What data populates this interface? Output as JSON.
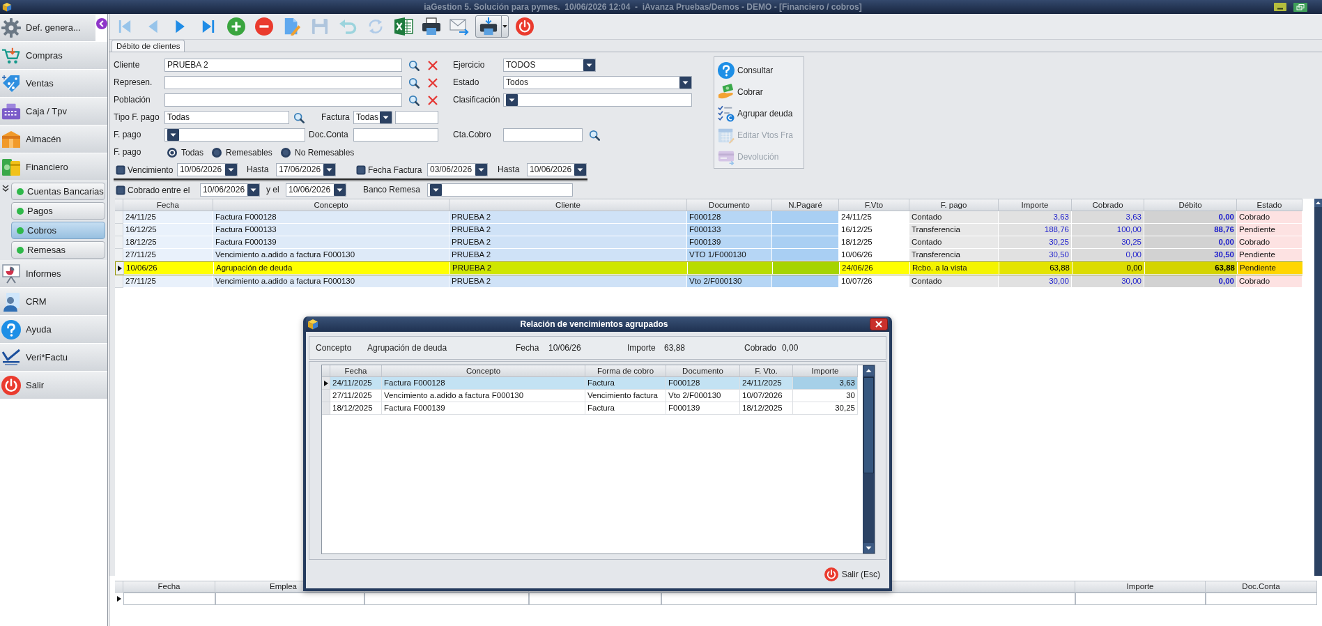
{
  "window": {
    "title": "iaGestion 5. Solución para pymes.  10/06/2026 12:04  -  iAvanza Pruebas/Demos - DEMO - [Financiero / cobros]"
  },
  "sidebar": {
    "items": [
      {
        "label": "Def. genera...",
        "kind": "settings"
      },
      {
        "label": "Compras",
        "kind": "cart"
      },
      {
        "label": "Ventas",
        "kind": "tag"
      },
      {
        "label": "Caja / Tpv",
        "kind": "register"
      },
      {
        "label": "Almacén",
        "kind": "box"
      },
      {
        "label": "Financiero",
        "kind": "money",
        "children": [
          {
            "label": "Cuentas Bancarias",
            "selected": false
          },
          {
            "label": "Pagos",
            "selected": false
          },
          {
            "label": "Cobros",
            "selected": true
          },
          {
            "label": "Remesas",
            "selected": false
          }
        ]
      },
      {
        "label": "Informes",
        "kind": "report"
      },
      {
        "label": "CRM",
        "kind": "contact"
      },
      {
        "label": "Ayuda",
        "kind": "help"
      },
      {
        "label": "Veri*Factu",
        "kind": "logo"
      },
      {
        "label": "Salir",
        "kind": "exit"
      }
    ]
  },
  "toolbar": {
    "buttons": [
      {
        "kind": "first",
        "disabled": true
      },
      {
        "kind": "previous",
        "disabled": true
      },
      {
        "kind": "next",
        "disabled": false
      },
      {
        "kind": "last",
        "disabled": false
      },
      {
        "kind": "add",
        "disabled": false
      },
      {
        "kind": "delete",
        "disabled": false
      },
      {
        "kind": "edit",
        "disabled": false
      },
      {
        "kind": "save",
        "disabled": true
      },
      {
        "kind": "undo",
        "disabled": true
      },
      {
        "kind": "refresh",
        "disabled": true
      },
      {
        "kind": "excel",
        "disabled": false
      },
      {
        "kind": "print",
        "disabled": false
      },
      {
        "kind": "email",
        "disabled": false
      },
      {
        "kind": "printmenu",
        "disabled": false
      },
      {
        "kind": "exit",
        "disabled": false
      }
    ]
  },
  "tabs": [
    {
      "label": "Débito de clientes",
      "selected": true
    }
  ],
  "filters": {
    "cliente": {
      "label": "Cliente",
      "value": "PRUEBA 2"
    },
    "represen": {
      "label": "Represen."
    },
    "poblacion": {
      "label": "Población"
    },
    "ejercicio": {
      "label": "Ejercicio",
      "value": "TODOS"
    },
    "estado": {
      "label": "Estado",
      "value": "Todos"
    },
    "clasificacion": {
      "label": "Clasificación"
    },
    "tipo_f_pago": {
      "label": "Tipo F. pago",
      "value": "Todas"
    },
    "factura": {
      "label": "Factura",
      "value": "Todas"
    },
    "f_pago": {
      "label": "F. pago"
    },
    "doc_conta": {
      "label": "Doc.Conta"
    },
    "cta_cobro": {
      "label": "Cta.Cobro"
    },
    "remesa_tipo": {
      "label": "F. pago",
      "options": [
        {
          "label": "Todas",
          "selected": true
        },
        {
          "label": "Remesables",
          "selected": false
        },
        {
          "label": "No Remesables",
          "selected": false
        }
      ]
    },
    "vencimiento": {
      "label": "Vencimiento",
      "checked": false,
      "from": "10/06/2026",
      "to_label": "Hasta",
      "to": "17/06/2026"
    },
    "fecha_factura": {
      "label": "Fecha Factura",
      "checked": false,
      "from": "03/06/2026",
      "to_label": "Hasta",
      "to": "10/06/2026"
    },
    "cobrado_entre": {
      "label": "Cobrado entre el",
      "checked": false,
      "from": "10/06/2026",
      "to_label": "y el",
      "to": "10/06/2026"
    },
    "banco_remesa": {
      "label": "Banco Remesa"
    }
  },
  "actions": [
    {
      "label": "Consultar",
      "kind": "help",
      "disabled": false
    },
    {
      "label": "Cobrar",
      "kind": "cash",
      "disabled": false
    },
    {
      "label": "Agrupar deuda",
      "kind": "group",
      "disabled": false
    },
    {
      "label": "Editar Vtos Fra",
      "kind": "calendar",
      "disabled": true
    },
    {
      "label": "Devolución",
      "kind": "card",
      "disabled": true
    }
  ],
  "table": {
    "columns": [
      "Fecha",
      "Concepto",
      "Cliente",
      "Documento",
      "N.Pagaré",
      "F.Vto",
      "F. pago",
      "Importe",
      "Cobrado",
      "Débito",
      "Estado"
    ],
    "rows": [
      {
        "fecha": "24/11/25",
        "concepto": "Factura F000128",
        "cliente": "PRUEBA 2",
        "documento": "F000128",
        "f_vto": "24/11/25",
        "f_pago": "Contado",
        "importe": "3,63",
        "cobrado": "3,63",
        "debito": "0,00",
        "estado": "Cobrado",
        "selected": false
      },
      {
        "fecha": "16/12/25",
        "concepto": "Factura F000133",
        "cliente": "PRUEBA 2",
        "documento": "F000133",
        "f_vto": "16/12/25",
        "f_pago": "Transferencia",
        "importe": "188,76",
        "cobrado": "100,00",
        "debito": "88,76",
        "estado": "Pendiente",
        "selected": false
      },
      {
        "fecha": "18/12/25",
        "concepto": "Factura F000139",
        "cliente": "PRUEBA 2",
        "documento": "F000139",
        "f_vto": "18/12/25",
        "f_pago": "Contado",
        "importe": "30,25",
        "cobrado": "30,25",
        "debito": "0,00",
        "estado": "Cobrado",
        "selected": false
      },
      {
        "fecha": "27/11/25",
        "concepto": "Vencimiento a.adido a factura F000130",
        "cliente": "PRUEBA 2",
        "documento": "VTO 1/F000130",
        "f_vto": "10/06/26",
        "f_pago": "Transferencia",
        "importe": "30,50",
        "cobrado": "0,00",
        "debito": "30,50",
        "estado": "Pendiente",
        "selected": false
      },
      {
        "fecha": "10/06/26",
        "concepto": "Agrupación de deuda",
        "cliente": "PRUEBA 2",
        "f_vto": "24/06/26",
        "f_pago": "Rcbo. a la vista",
        "importe": "63,88",
        "cobrado": "0,00",
        "debito": "63,88",
        "estado": "Pendiente",
        "selected": true
      },
      {
        "fecha": "27/11/25",
        "concepto": "Vencimiento a.adido a factura F000130",
        "cliente": "PRUEBA 2",
        "documento": "Vto 2/F000130",
        "f_vto": "10/07/26",
        "f_pago": "Contado",
        "importe": "30,00",
        "cobrado": "30,00",
        "debito": "0,00",
        "estado": "Cobrado",
        "selected": false
      }
    ]
  },
  "dialog": {
    "title": "Relación de vencimientos agrupados",
    "info": [
      {
        "label": "Concepto",
        "value": "Agrupación de deuda"
      },
      {
        "label": "Fecha",
        "value": "10/06/26"
      },
      {
        "label": "Importe",
        "value": "63,88"
      },
      {
        "label": "Cobrado",
        "value": "0,00"
      }
    ],
    "table": {
      "columns": [
        "Fecha",
        "Concepto",
        "Forma de cobro",
        "Documento",
        "F. Vto.",
        "Importe"
      ],
      "rows": [
        {
          "fecha": "24/11/2025",
          "concepto": "Factura F000128",
          "forma_de_cobro": "Factura",
          "documento": "F000128",
          "f_vto": "24/11/2025",
          "importe": "3,63",
          "selected": true
        },
        {
          "fecha": "27/11/2025",
          "concepto": "Vencimiento a.adido a factura F000130",
          "forma_de_cobro": "Vencimiento factura",
          "documento": "Vto 2/F000130",
          "f_vto": "10/07/2026",
          "importe": "30",
          "selected": false
        },
        {
          "fecha": "18/12/2025",
          "concepto": "Factura F000139",
          "forma_de_cobro": "Factura",
          "documento": "F000139",
          "f_vto": "18/12/2025",
          "importe": "30,25",
          "selected": false
        }
      ]
    },
    "buttons": [
      {
        "label": "Salir (Esc)",
        "kind": "exit"
      }
    ]
  },
  "detail_table": {
    "columns": [
      "Fecha",
      "Emplea",
      "Importe",
      "Doc.Conta"
    ]
  }
}
